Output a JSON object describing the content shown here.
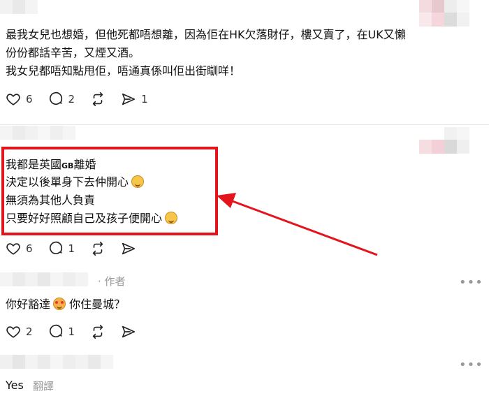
{
  "post1": {
    "lines": [
      "最我女兒也想婚，但他死都唔想離，因為佢在HK欠落財仔，樓又賣了，在UK又懶",
      "份份都話辛苦，又煙又酒。",
      "我女兒都唔知點甩佢，唔通真係叫佢出街瞓咩！"
    ],
    "likes": "6",
    "comments": "2",
    "shares": "1"
  },
  "post2": {
    "line1_pre": "我都是英國",
    "line1_gb": "GB",
    "line1_post": "離婚",
    "line2": "決定以後單身下去仲開心",
    "line3": "無須為其他人負責",
    "line4": "只要好好照顧自己及孩子便開心",
    "likes": "6",
    "comments": "1"
  },
  "reply1": {
    "author_tag": "· 作者",
    "text_pre": "你好豁達",
    "text_post": " 你住曼城？",
    "likes": "2",
    "comments": "1"
  },
  "reply2": {
    "text": "Yes",
    "translate": "翻譯"
  },
  "more_menu": "•••",
  "colors": {
    "highlight": "#e3141b",
    "arrow": "#e3141b"
  }
}
